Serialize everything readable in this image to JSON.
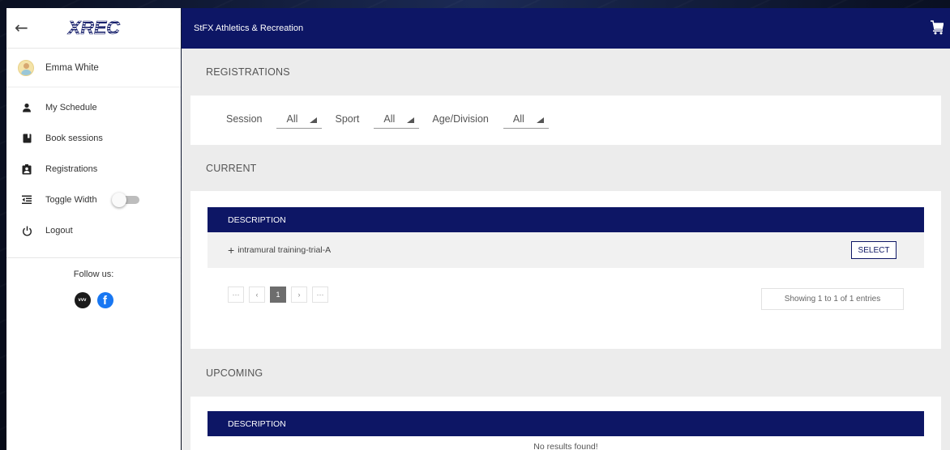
{
  "sidebar": {
    "logo_text": "XREC",
    "user_name": "Emma White",
    "items": [
      {
        "label": "My Schedule",
        "icon": "person-icon"
      },
      {
        "label": "Book sessions",
        "icon": "book-icon"
      },
      {
        "label": "Registrations",
        "icon": "badge-icon"
      },
      {
        "label": "Toggle Width",
        "icon": "indent-icon"
      },
      {
        "label": "Logout",
        "icon": "power-icon"
      }
    ],
    "toggle_width_on": false,
    "follow_label": "Follow us:",
    "social": [
      "vimeo-icon",
      "facebook-icon"
    ],
    "vimeo_text": "vvv",
    "facebook_text": "f"
  },
  "header": {
    "title": "StFX Athletics & Recreation",
    "cart_icon": "cart-icon"
  },
  "registrations": {
    "title": "REGISTRATIONS",
    "filters": [
      {
        "label": "Session",
        "value": "All"
      },
      {
        "label": "Sport",
        "value": "All"
      },
      {
        "label": "Age/Division",
        "value": "All"
      }
    ]
  },
  "current": {
    "title": "CURRENT",
    "column_header": "DESCRIPTION",
    "rows": [
      {
        "expand": "+",
        "description": "intramural training-trial-A",
        "action": "SELECT"
      }
    ],
    "pager": [
      "···",
      "‹",
      "1",
      "›",
      "···"
    ],
    "showing": "Showing 1 to 1 of 1 entries"
  },
  "upcoming": {
    "title": "UPCOMING",
    "column_header": "DESCRIPTION",
    "empty_text": "No results found!"
  },
  "colors": {
    "navy": "#0d1665",
    "sidebar_bg": "#ffffff",
    "main_bg": "#ececec"
  }
}
